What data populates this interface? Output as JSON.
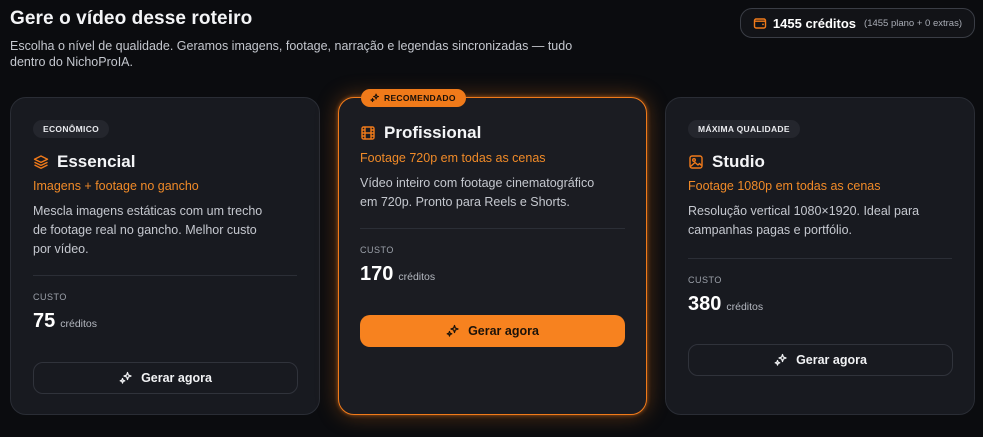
{
  "header": {
    "title": "Gere o vídeo desse roteiro",
    "subtitle_line1": "Escolha o nível de qualidade. Geramos imagens, footage, narração e legendas sincronizadas — tudo",
    "subtitle_line2": "dentro do NichoProIA."
  },
  "credits": {
    "main": "1455 créditos",
    "detail": "(1455 plano + 0 extras)"
  },
  "colors": {
    "accent": "#f07a1a",
    "background": "#0b0c0f",
    "card": "#181a20"
  },
  "cards": [
    {
      "badge": "ECONÔMICO",
      "icon": "layers-icon",
      "title": "Essencial",
      "tagline": "Imagens + footage no gancho",
      "desc_lines": [
        "Mescla imagens estáticas com um trecho",
        "de footage real no gancho. Melhor custo",
        "por vídeo."
      ],
      "cost_label": "CUSTO",
      "cost_value": "75",
      "cost_unit": "créditos",
      "button": "Gerar agora"
    },
    {
      "badge": "RECOMENDADO",
      "icon": "film-icon",
      "title": "Profissional",
      "tagline": "Footage 720p em todas as cenas",
      "desc_lines": [
        "Vídeo inteiro com footage cinematográfico",
        "em 720p. Pronto para Reels e Shorts."
      ],
      "cost_label": "CUSTO",
      "cost_value": "170",
      "cost_unit": "créditos",
      "button": "Gerar agora"
    },
    {
      "badge": "MÁXIMA QUALIDADE",
      "icon": "image-icon",
      "title": "Studio",
      "tagline": "Footage 1080p em todas as cenas",
      "desc_lines": [
        "Resolução vertical 1080×1920. Ideal para",
        "campanhas pagas e portfólio."
      ],
      "cost_label": "CUSTO",
      "cost_value": "380",
      "cost_unit": "créditos",
      "button": "Gerar agora"
    }
  ]
}
